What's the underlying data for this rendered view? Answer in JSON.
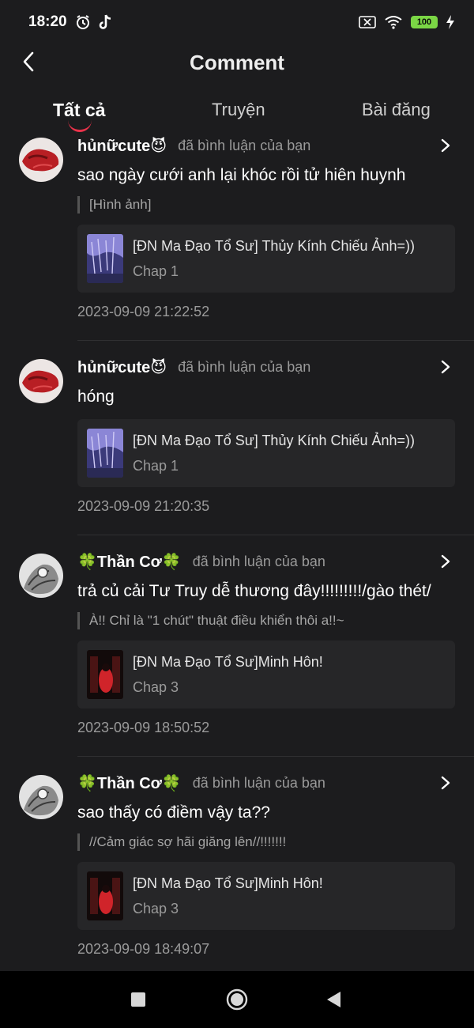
{
  "status_bar": {
    "time": "18:20",
    "battery": "100",
    "icons": [
      "alarm-icon",
      "tiktok-icon",
      "sim-off-icon",
      "wifi-icon",
      "battery-icon",
      "charging-icon"
    ]
  },
  "header": {
    "title": "Comment"
  },
  "tabs": [
    {
      "label": "Tất cả",
      "active": true
    },
    {
      "label": "Truyện",
      "active": false
    },
    {
      "label": "Bài đăng",
      "active": false
    }
  ],
  "colors": {
    "background": "#1c1c1e",
    "card": "#262628",
    "accent": "#e8324a",
    "battery": "#7bd645"
  },
  "comments": [
    {
      "username": "hủnữcute😈",
      "action": "đã bình luận của bạn",
      "text": "sao ngày cưới anh lại khóc rồi tử hiên huynh",
      "quote": "[Hình ảnh]",
      "story_title": "[ĐN Ma Đạo Tổ Sư] Thủy Kính Chiếu Ảnh=))",
      "chapter": "Chap 1",
      "timestamp": "2023-09-09 21:22:52"
    },
    {
      "username": "hủnữcute😈",
      "action": "đã bình luận của bạn",
      "text": "hóng",
      "quote": "",
      "story_title": "[ĐN Ma Đạo Tổ Sư] Thủy Kính Chiếu Ảnh=))",
      "chapter": "Chap 1",
      "timestamp": "2023-09-09 21:20:35"
    },
    {
      "username": "🍀Thần Cơ🍀",
      "action": "đã bình luận của bạn",
      "text": "trả củ cải Tư Truy dễ thương đây!!!!!!!!!/gào thét/",
      "quote": "À!! Chỉ là \"1 chút\" thuật điều khiển thôi a!!~",
      "story_title": "[ĐN Ma Đạo Tổ Sư]Minh Hôn!",
      "chapter": "Chap 3",
      "timestamp": "2023-09-09 18:50:52"
    },
    {
      "username": "🍀Thần Cơ🍀",
      "action": "đã bình luận của bạn",
      "text": "sao thấy có điềm vậy ta??",
      "quote": "//Cảm giác sợ hãi giăng lên//!!!!!!!",
      "story_title": "[ĐN Ma Đạo Tổ Sư]Minh Hôn!",
      "chapter": "Chap 3",
      "timestamp": "2023-09-09 18:49:07"
    }
  ],
  "nav": {
    "icons": [
      "recents-square-icon",
      "home-circle-icon",
      "back-triangle-icon"
    ]
  }
}
